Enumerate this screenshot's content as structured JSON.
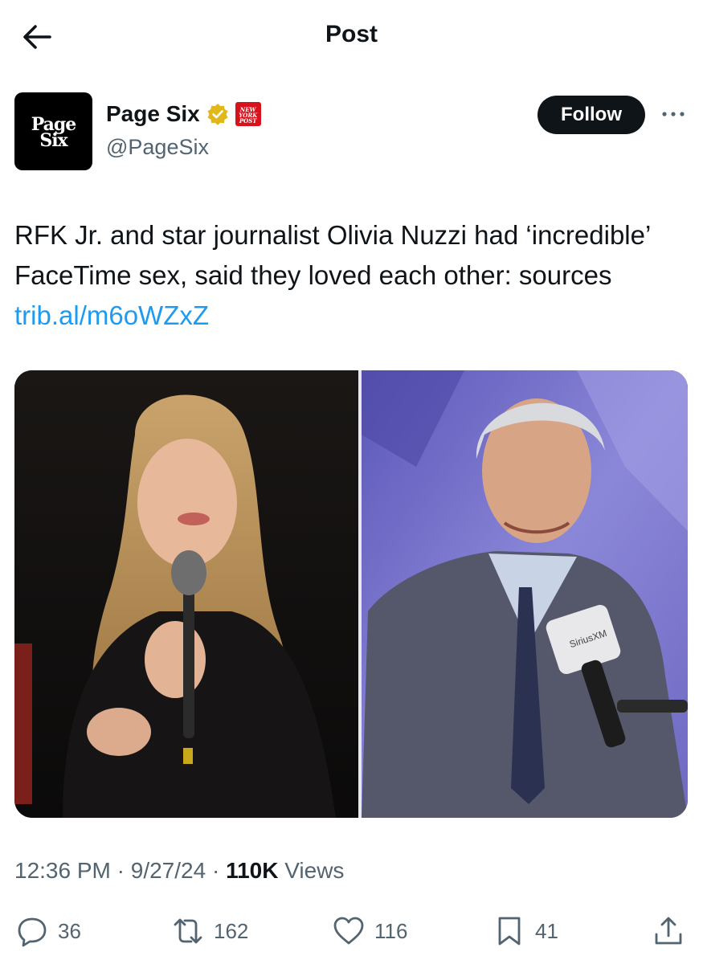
{
  "header": {
    "title": "Post",
    "back_icon": "arrow-left-icon"
  },
  "author": {
    "avatar_text_line1": "Page",
    "avatar_text_line2": "Six",
    "name": "Page Six",
    "handle": "@PageSix",
    "verified_badge": "gold-verified-badge-icon",
    "affiliate_badge_lines": [
      "NEW",
      "YORK",
      "POST"
    ],
    "follow_label": "Follow"
  },
  "post": {
    "text": "RFK Jr. and star journalist Olivia Nuzzi had ‘incredible’ FaceTime sex, said they loved each other: sources ",
    "link": "trib.al/m6oWZxZ",
    "media_mic_label": "SiriusXM"
  },
  "meta": {
    "time": "12:36 PM",
    "date": "9/27/24",
    "views_count": "110K",
    "views_label": "Views",
    "separator": "·"
  },
  "actions": {
    "replies": "36",
    "reposts": "162",
    "likes": "116",
    "bookmarks": "41"
  },
  "colors": {
    "accent": "#1d9bf0",
    "text": "#0f1419",
    "muted": "#536471",
    "nyp_red": "#d8121b"
  }
}
